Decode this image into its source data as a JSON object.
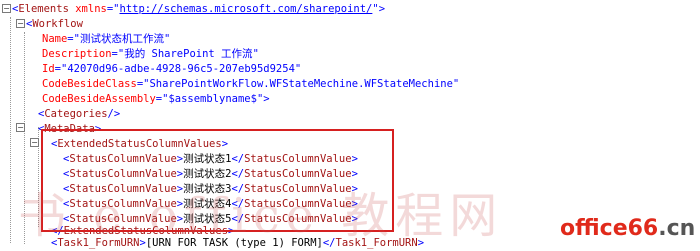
{
  "xml": {
    "root": {
      "tag": "Elements",
      "attr_name": "xmlns",
      "attr_value": "http://schemas.microsoft.com/sharepoint/"
    },
    "workflow": {
      "tag": "Workflow",
      "attributes": [
        {
          "name": "Name",
          "value": "测试状态机工作流"
        },
        {
          "name": "Description",
          "value": "我的 SharePoint 工作流"
        },
        {
          "name": "Id",
          "value": "42070d96-adbe-4928-96c5-207eb95d9254"
        },
        {
          "name": "CodeBesideClass",
          "value": "SharePointWorkFlow.WFStateMechine.WFStateMechine"
        },
        {
          "name": "CodeBesideAssembly",
          "value": "$assemblyname$"
        }
      ]
    },
    "categories": {
      "tag": "Categories"
    },
    "metadata": {
      "tag": "MetaData"
    },
    "extended": {
      "tag": "ExtendedStatusColumnValues"
    },
    "status_values": [
      {
        "tag": "StatusColumnValue",
        "text": "测试状态1"
      },
      {
        "tag": "StatusColumnValue",
        "text": "测试状态2"
      },
      {
        "tag": "StatusColumnValue",
        "text": "测试状态3"
      },
      {
        "tag": "StatusColumnValue",
        "text": "测试状态4"
      },
      {
        "tag": "StatusColumnValue",
        "text": "测试状态5"
      }
    ],
    "task": {
      "tag": "Task1_FormURN",
      "text": "[URN FOR TASK (type 1) FORM]"
    }
  },
  "watermark": {
    "text": "书 e office 教程网"
  },
  "logo": {
    "text": "office66",
    "suffix": ".cn"
  },
  "colors": {
    "bracket": "#0000ff",
    "tag": "#a31515",
    "attribute": "#ff0000",
    "value": "#0000ff",
    "highlight": "#d62020",
    "logo": "#e02a1b"
  }
}
